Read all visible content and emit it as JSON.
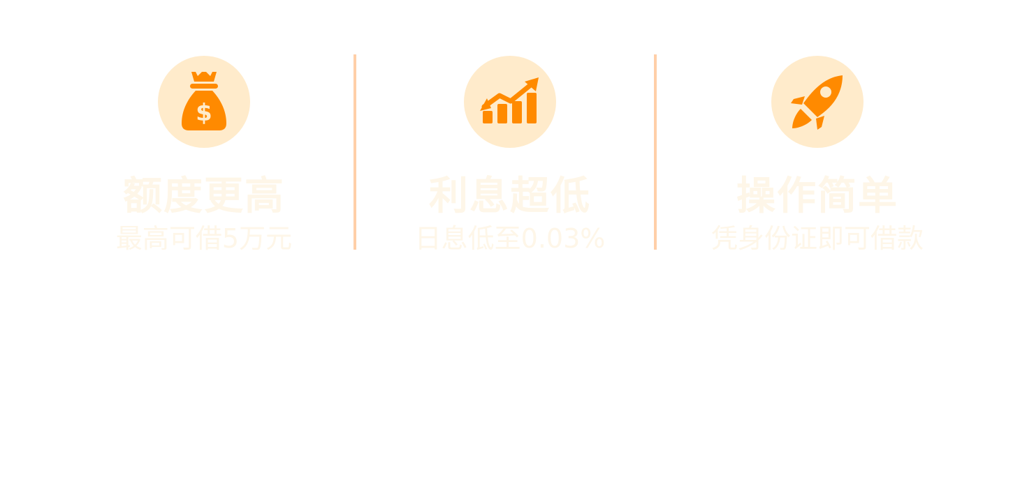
{
  "colors": {
    "icon_circle_bg": "#ffebcb",
    "icon_fill": "#ff8a00",
    "icon_inner": "#ffebcb",
    "divider": "#ffcfa8",
    "title_text": "#fef6e8",
    "desc_text": "#fef6e8"
  },
  "features": [
    {
      "icon": "money-bag-icon",
      "title": "额度更高",
      "desc": "最高可借5万元"
    },
    {
      "icon": "growth-chart-icon",
      "title": "利息超低",
      "desc": "日息低至0.03%"
    },
    {
      "icon": "rocket-icon",
      "title": "操作简单",
      "desc": "凭身份证即可借款"
    }
  ]
}
